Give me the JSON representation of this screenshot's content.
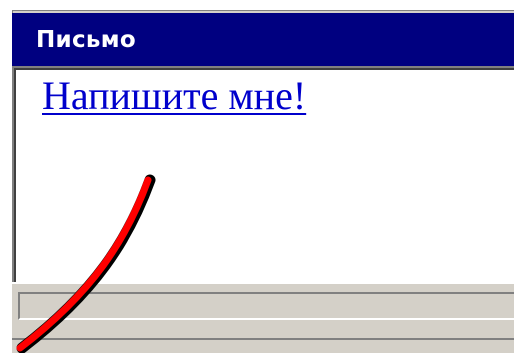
{
  "window": {
    "title": "Письмо"
  },
  "content": {
    "link_text": "Напишите мне!"
  },
  "colors": {
    "title_bar": "#000080",
    "link": "#0000cc",
    "chrome": "#d4d0c8",
    "annotation_arrow": "#ff0000"
  },
  "icons": {
    "annotation": "red-pointer-arrow"
  }
}
